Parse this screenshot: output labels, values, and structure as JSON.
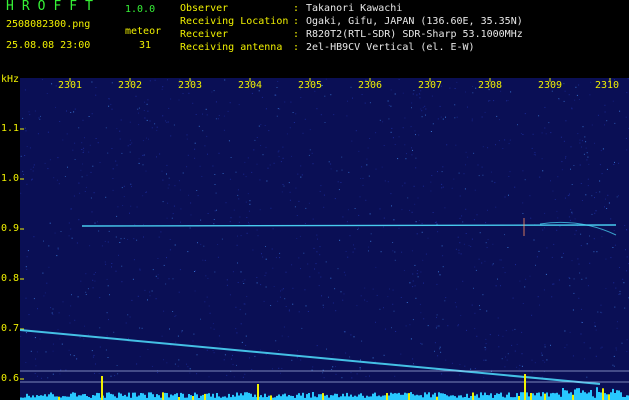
{
  "header": {
    "title": "HROFFT",
    "version": "1.0.0",
    "filename": "2508082300.png",
    "meteor_label": "meteor",
    "datetime": "25.08.08 23:00",
    "meteor_count": "31"
  },
  "info": [
    {
      "label": "Observer",
      "value": "Takanori Kawachi"
    },
    {
      "label": "Receiving Location",
      "value": "Ogaki, Gifu, JAPAN (136.60E, 35.35N)"
    },
    {
      "label": "Receiver",
      "value": "R820T2(RTL-SDR) SDR-Sharp 53.1000MHz"
    },
    {
      "label": "Receiving antenna",
      "value": "2el-HB9CV Vertical (el. E-W)"
    }
  ],
  "axis": {
    "y_unit": "kHz",
    "x_ticks": [
      "2301",
      "2302",
      "2303",
      "2304",
      "2305",
      "2306",
      "2307",
      "2308",
      "2309",
      "2310"
    ],
    "y_ticks": [
      "1.1",
      "1.0",
      "0.9",
      "0.8",
      "0.7",
      "0.6"
    ]
  },
  "colors": {
    "background": "#000000",
    "spectrogram": "#0a0f55",
    "header_text": "#36f236",
    "axis_text": "#f0f000",
    "signal": "#4fe0ff",
    "activity": "#28c8ff"
  }
}
